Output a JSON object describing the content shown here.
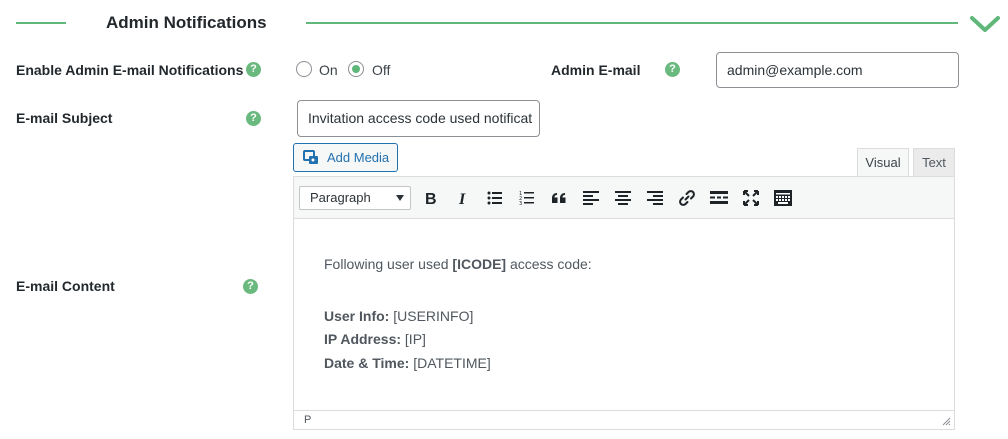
{
  "section": {
    "title": "Admin Notifications"
  },
  "enable": {
    "label": "Enable Admin E-mail Notifications",
    "options": [
      "On",
      "Off"
    ],
    "selected": "Off"
  },
  "admin_email": {
    "label": "Admin E-mail",
    "value": "admin@example.com"
  },
  "subject": {
    "label": "E-mail Subject",
    "value": "Invitation access code used notificat"
  },
  "content": {
    "label": "E-mail Content",
    "add_media": "Add Media",
    "tabs": {
      "visual": "Visual",
      "text": "Text",
      "active": "Visual"
    },
    "format": "Paragraph",
    "intro_pre": "Following user used ",
    "intro_code": "[ICODE]",
    "intro_post": " access code:",
    "lines": [
      {
        "key": "User Info:",
        "value": "[USERINFO]"
      },
      {
        "key": "IP Address:",
        "value": "[IP]"
      },
      {
        "key": "Date & Time:",
        "value": "[DATETIME]"
      }
    ],
    "path": "P"
  },
  "help_glyph": "?",
  "colors": {
    "accent": "#5fb77a",
    "link": "#2271b1",
    "help": "#6ab97f"
  },
  "icons": [
    "chevron-down-icon",
    "help-icon",
    "add-media-icon",
    "bold-icon",
    "italic-icon",
    "bullet-list-icon",
    "numbered-list-icon",
    "blockquote-icon",
    "align-left-icon",
    "align-center-icon",
    "align-right-icon",
    "link-icon",
    "read-more-icon",
    "fullscreen-icon",
    "toolbar-toggle-icon",
    "resize-grip-icon"
  ]
}
